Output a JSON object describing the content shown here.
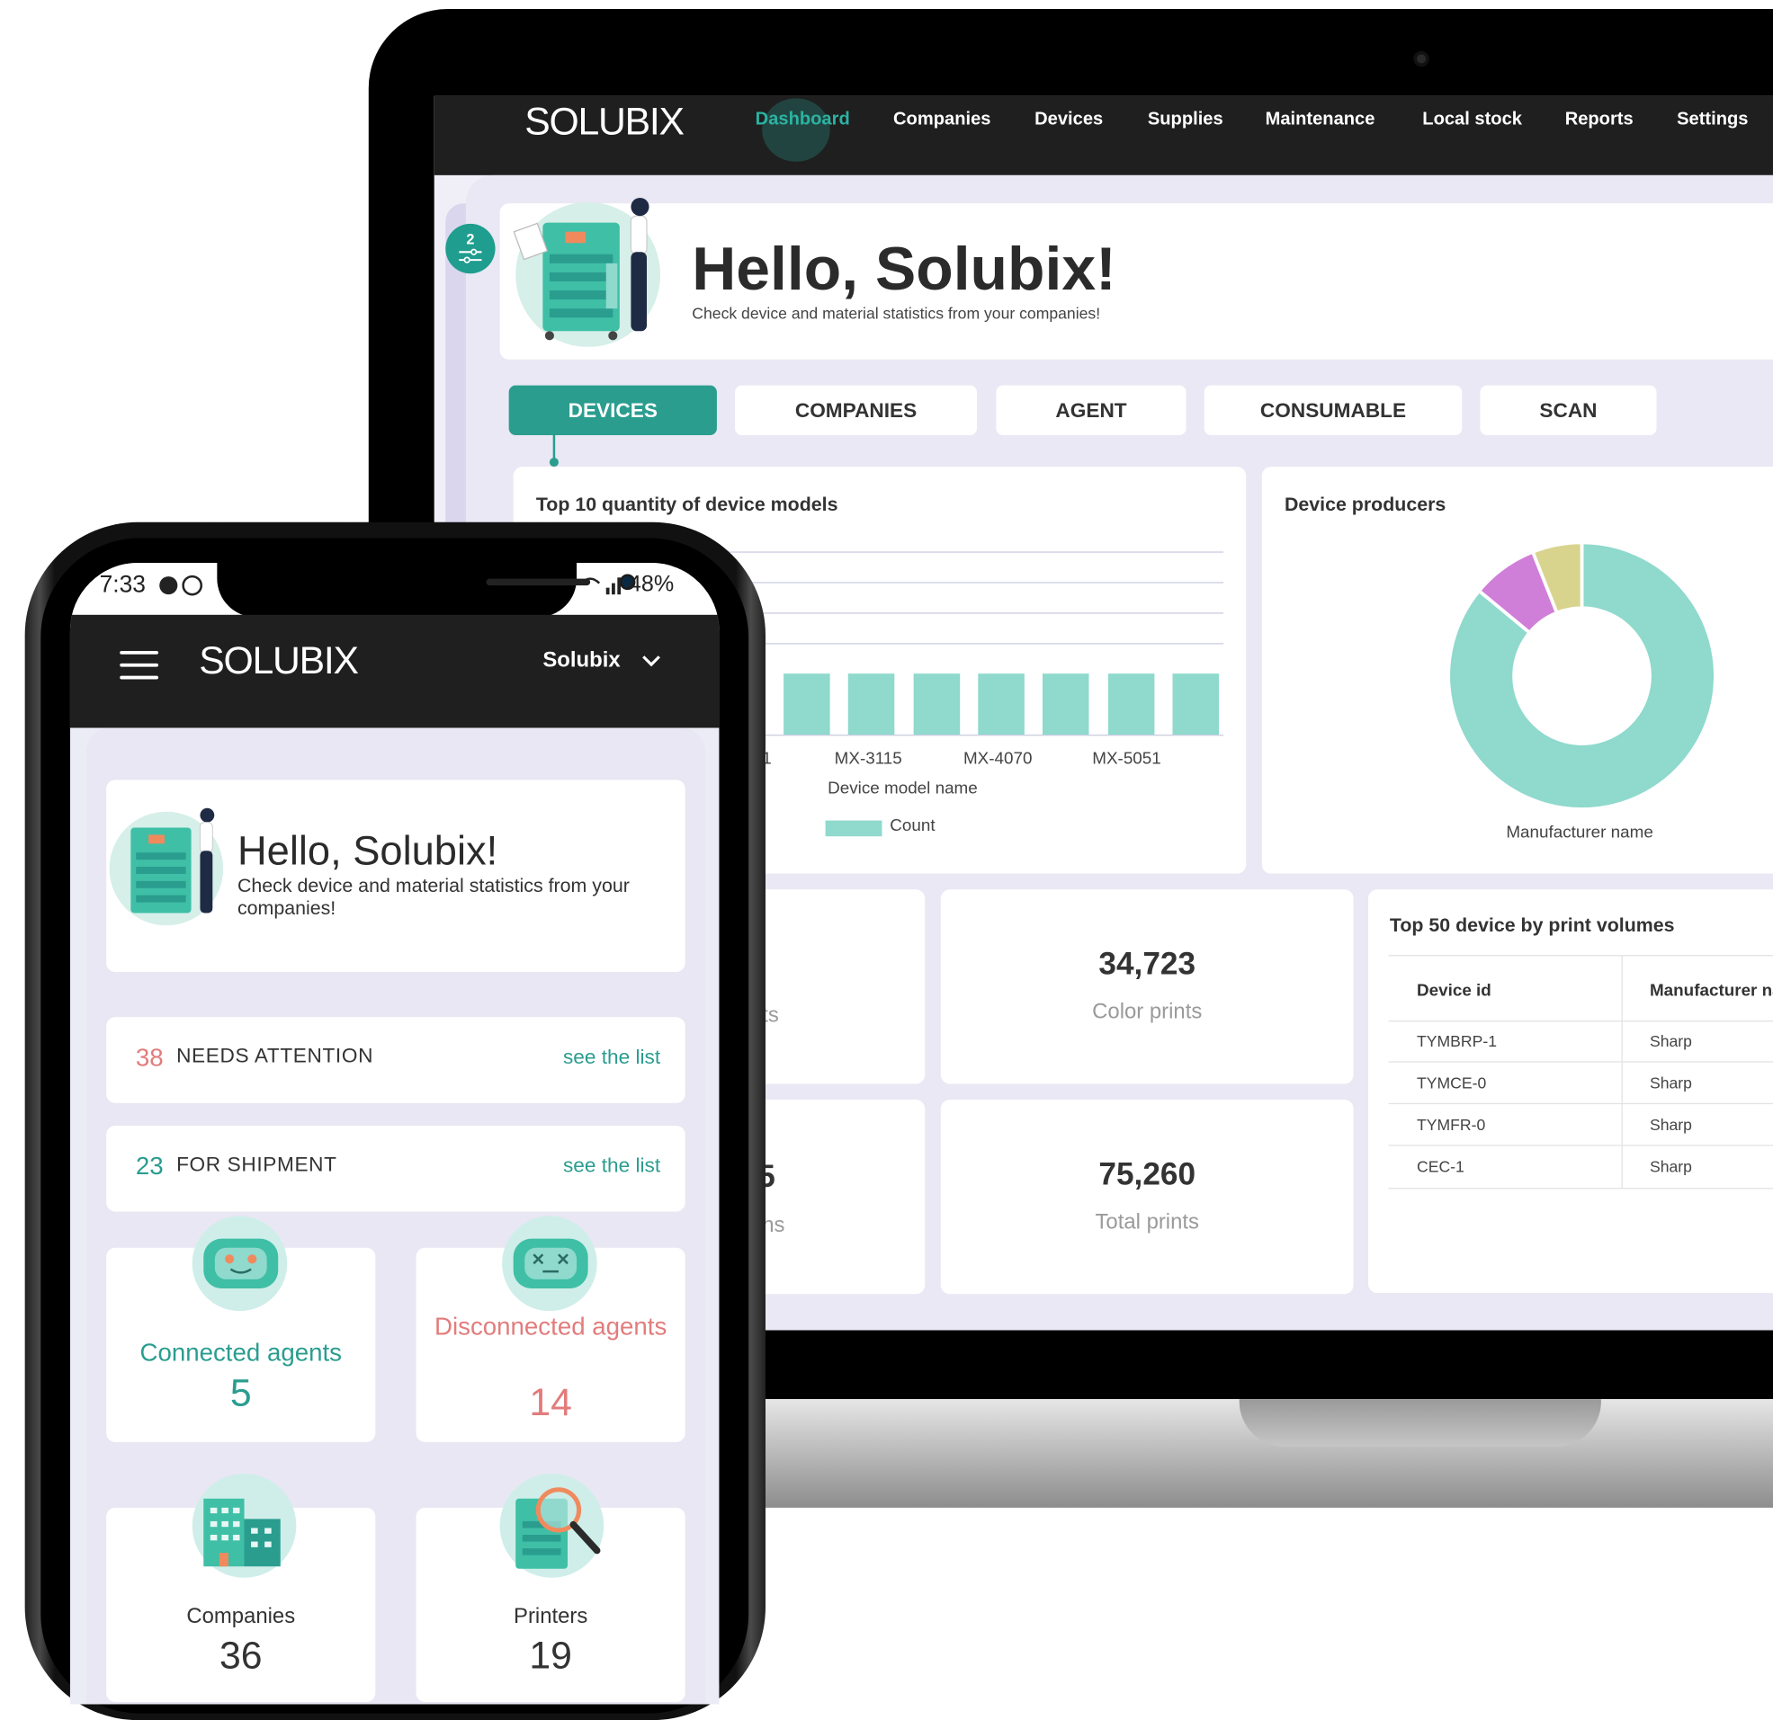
{
  "laptop": {
    "logo": "SOLUBIX",
    "nav": [
      "Dashboard",
      "Companies",
      "Devices",
      "Supplies",
      "Maintenance",
      "Local stock",
      "Reports",
      "Settings"
    ],
    "filter_badge": "2",
    "hello_title": "Hello, Solubix!",
    "hello_subtitle": "Check device and material statistics from your companies!",
    "tabs": [
      "DEVICES",
      "COMPANIES",
      "AGENT",
      "CONSUMABLE",
      "SCAN"
    ],
    "bar_chart_title": "Top 10 quantity of device models",
    "pie_chart_title": "Device producers",
    "stats": [
      {
        "value": "34,723",
        "label": "Color prints"
      },
      {
        "value": "75,260",
        "label": "Total prints"
      }
    ],
    "partial_stat_labels": [
      "ts",
      "ns"
    ],
    "partial_stat_values": [
      "",
      "5"
    ],
    "table_title": "Top 50 device by print volumes",
    "table_headers": [
      "Device id",
      "Manufacturer na"
    ],
    "table_rows": [
      [
        "TYMBRP-1",
        "Sharp"
      ],
      [
        "TYMCE-0",
        "Sharp"
      ],
      [
        "TYMFR-0",
        "Sharp"
      ],
      [
        "CEC-1",
        "Sharp"
      ]
    ]
  },
  "phone": {
    "time": "7:33",
    "battery": "48%",
    "logo": "SOLUBIX",
    "company": "Solubix",
    "hello_title": "Hello, Solubix!",
    "hello_subtitle": "Check device and material statistics from your companies!",
    "needs_attention": {
      "count": "38",
      "label": "NEEDS ATTENTION",
      "link": "see the list"
    },
    "for_shipment": {
      "count": "23",
      "label": "FOR SHIPMENT",
      "link": "see the list"
    },
    "connected": {
      "label": "Connected agents",
      "value": "5"
    },
    "disconnected": {
      "label": "Disconnected agents",
      "value": "14"
    },
    "companies": {
      "label": "Companies",
      "value": "36"
    },
    "printers": {
      "label": "Printers",
      "value": "19"
    }
  },
  "colors": {
    "teal": "#2a9d8f",
    "bar": "#8fd9cd",
    "pink": "#e27c7c",
    "purple": "#d07fd9",
    "olive": "#d8d48e"
  },
  "chart_data": [
    {
      "type": "bar",
      "title": "Top 10 quantity of device models",
      "xlabel": "Device model name",
      "ylabel": "",
      "categories": [
        "MX-3115",
        "MX-4070",
        "MX-5051"
      ],
      "series": [
        {
          "name": "Count",
          "values": [
            1,
            1,
            1
          ]
        }
      ],
      "visible_tick_fragment": "1",
      "grid": true,
      "legend": "bottom"
    },
    {
      "type": "pie",
      "title": "Device producers",
      "xlabel": "Manufacturer name",
      "slices": [
        {
          "value": 86,
          "color": "#8fd9cd"
        },
        {
          "value": 8,
          "color": "#d07fd9"
        },
        {
          "value": 6,
          "color": "#d8d48e"
        }
      ],
      "donut": true
    }
  ]
}
